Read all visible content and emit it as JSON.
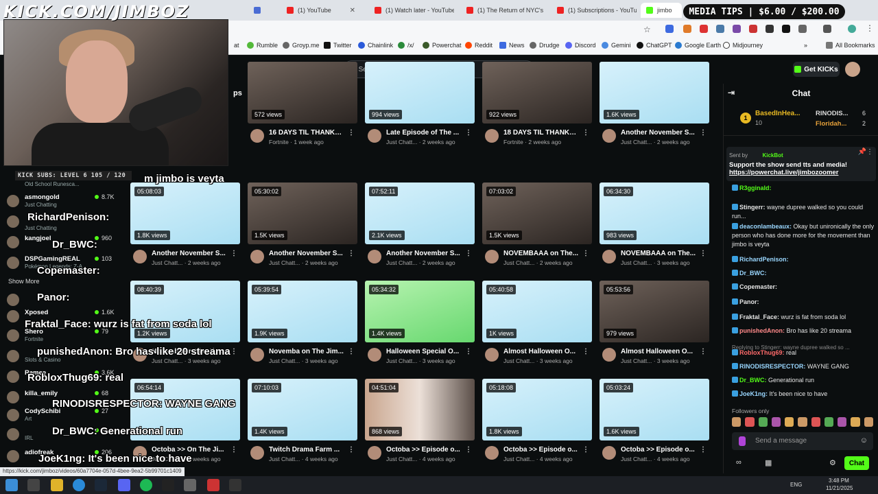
{
  "browser": {
    "tabs": [
      {
        "label": "(1) YouTube",
        "color": "#e22"
      },
      {
        "label": "(1) Watch later - YouTube",
        "color": "#e22"
      },
      {
        "label": "(1) The Return of NYC's",
        "color": "#e22"
      },
      {
        "label": "(1) Subscriptions - YouTube",
        "color": "#e22"
      },
      {
        "label": "jimbo",
        "color": "#53fc18"
      }
    ],
    "bookmarks": [
      "Rumble",
      "Groyp.me",
      "Twitter",
      "Chainlink",
      "/x/",
      "Powerchat",
      "Reddit",
      "News",
      "Drudge",
      "Discord",
      "Gemini",
      "ChatGPT",
      "Google Earth",
      "Midjourney"
    ],
    "all_bookmarks": "All Bookmarks",
    "status_url": "https://kick.com/jimboz/videos/60a7704e-057d-4bee-9ea2-5b99701c1409"
  },
  "overlay": {
    "watermark": "KICK.COM/JIMBOZ",
    "media_tips": "MEDIA TIPS | $6.00 / $200.00",
    "kick_subs": "KICK SUBS: LEVEL 6 105 / 120",
    "overlay_texts": [
      {
        "text": "m jimbo is veyta"
      },
      {
        "text": "RichardPenison:"
      },
      {
        "text": "Dr_BWC:"
      },
      {
        "text": "Copemaster:"
      },
      {
        "text": "Panor:"
      },
      {
        "text": "Fraktal_Face: wurz is fat from soda lol"
      },
      {
        "text": "punishedAnon:  Bro has like 20 streama"
      },
      {
        "text": "RobloxThug69: real"
      },
      {
        "text": "RINODISRESPECTOR: WAYNE GANG"
      },
      {
        "text": "Dr_BWC: Generational run"
      },
      {
        "text": "JoeK1ng: It's been nice to have"
      }
    ]
  },
  "header": {
    "search_placeholder": "Search",
    "get_kicks": "Get KICKs",
    "section_tail": "ps"
  },
  "sidebar": {
    "show_more": "Show More",
    "channels": [
      {
        "name": "Old School Runesca...",
        "category": "",
        "views": ""
      },
      {
        "name": "asmongold",
        "category": "Just Chatting",
        "views": "8.7K"
      },
      {
        "name": "asmon",
        "category": "Just Chatting",
        "views": ""
      },
      {
        "name": "kangjoel",
        "category": "",
        "views": "960"
      },
      {
        "name": "DSPGamingREAL",
        "category": "Pokémon Legends: Z-A",
        "views": "103"
      },
      {
        "name": "xQc",
        "category": "",
        "views": ""
      },
      {
        "name": "Xposed",
        "category": "",
        "views": "1.6K"
      },
      {
        "name": "Shero",
        "category": "Fortnite",
        "views": "79"
      },
      {
        "name": "",
        "category": "Slots & Casino",
        "views": ""
      },
      {
        "name": "Ramee",
        "category": "",
        "views": "3.6K"
      },
      {
        "name": "killa_emily",
        "category": "",
        "views": "68"
      },
      {
        "name": "CodySchibi",
        "category": "Art",
        "views": "27"
      },
      {
        "name": "",
        "category": "IRL",
        "views": "2"
      },
      {
        "name": "adiofreak",
        "category": "",
        "views": "206"
      }
    ]
  },
  "videos": [
    {
      "duration": "",
      "views": "572 views",
      "title": "16 DAYS TIL THANKSGIVING",
      "sub": "Fortnite · 1 week ago",
      "thumb": "cam"
    },
    {
      "duration": "",
      "views": "994 views",
      "title": "Late Episode of The ...",
      "sub": "Just Chatt... · 2 weeks ago",
      "thumb": "blue"
    },
    {
      "duration": "",
      "views": "922 views",
      "title": "18 DAYS TIL THANKSGIVING",
      "sub": "Fortnite · 2 weeks ago",
      "thumb": "cam"
    },
    {
      "duration": "",
      "views": "1.6K views",
      "title": "Another November S...",
      "sub": "Just Chatt... · 2 weeks ago",
      "thumb": "blue"
    },
    {
      "duration": "05:08:03",
      "views": "1.8K views",
      "title": "Another November S...",
      "sub": "Just Chatt... · 2 weeks ago",
      "thumb": "blue"
    },
    {
      "duration": "05:30:02",
      "views": "1.5K views",
      "title": "Another November S...",
      "sub": "Just Chatt... · 2 weeks ago",
      "thumb": "cam"
    },
    {
      "duration": "07:52:11",
      "views": "2.1K views",
      "title": "Another November S...",
      "sub": "Just Chatt... · 2 weeks ago",
      "thumb": "blue"
    },
    {
      "duration": "07:03:02",
      "views": "1.5K views",
      "title": "NOVEMBAAA on The...",
      "sub": "Just Chatt... · 2 weeks ago",
      "thumb": "cam"
    },
    {
      "duration": "06:34:30",
      "views": "983 views",
      "title": "NOVEMBAAA on The...",
      "sub": "Just Chatt... · 3 weeks ago",
      "thumb": "blue"
    },
    {
      "duration": "08:40:39",
      "views": "1.2K views",
      "title": "Novemba on The Jim...",
      "sub": "Just Chatt... · 3 weeks ago",
      "thumb": "blue"
    },
    {
      "duration": "05:39:54",
      "views": "1.9K views",
      "title": "Novemba on The Jim...",
      "sub": "Just Chatt... · 3 weeks ago",
      "thumb": "blue"
    },
    {
      "duration": "05:34:32",
      "views": "1.4K views",
      "title": "Halloween Special O...",
      "sub": "Just Chatt... · 3 weeks ago",
      "thumb": "green"
    },
    {
      "duration": "05:40:58",
      "views": "1K views",
      "title": "Almost Halloween O...",
      "sub": "Just Chatt... · 3 weeks ago",
      "thumb": "blue"
    },
    {
      "duration": "05:53:56",
      "views": "979 views",
      "title": "Almost Halloween O...",
      "sub": "Just Chatt... · 3 weeks ago",
      "thumb": "cam"
    },
    {
      "duration": "06:54:14",
      "views": "",
      "title": "Octoba >> On The Ji...",
      "sub": "Just Chatt... · 4 weeks ago",
      "thumb": "blue"
    },
    {
      "duration": "07:10:03",
      "views": "1.4K views",
      "title": "Twitch Drama Farm ...",
      "sub": "Just Chatt... · 4 weeks ago",
      "thumb": "blue"
    },
    {
      "duration": "04:51:04",
      "views": "868 views",
      "title": "Octoba >> Episode o...",
      "sub": "Just Chatt... · 4 weeks ago",
      "thumb": "stream"
    },
    {
      "duration": "05:18:08",
      "views": "1.8K views",
      "title": "Octoba >> Episode o...",
      "sub": "Just Chatt... · 4 weeks ago",
      "thumb": "blue"
    },
    {
      "duration": "05:03:24",
      "views": "1.6K views",
      "title": "Octoba >> Episode o...",
      "sub": "Just Chatt... · 4 weeks ago",
      "thumb": "blue"
    }
  ],
  "chat": {
    "title": "Chat",
    "leaderboard": [
      {
        "rank": "1",
        "name": "BasedInHea...",
        "count": "10"
      },
      {
        "name": "RINODIS...",
        "count": "6"
      },
      {
        "name": "Floridah...",
        "count": "2"
      }
    ],
    "pinned": {
      "sent_by": "Sent by",
      "sender": "KickBot",
      "text": "Support the show send tts and media!",
      "link": "https://powerchat.live/jimbozoomer"
    },
    "messages": [
      {
        "user": "R3gginaId:",
        "text": "",
        "color": "#53fc18"
      },
      {
        "user": "Stingerr:",
        "text": "wayne dupree walked so you could run...",
        "color": "#e6e6e6"
      },
      {
        "user": "deaconlambeaux:",
        "text": "Okay but unironically the only person who has done more for the movement than jimbo is veyta",
        "color": "#9ad7ff"
      },
      {
        "user": "RichardPenison:",
        "text": "",
        "color": "#9ad7ff"
      },
      {
        "user": "Dr_BWC:",
        "text": "",
        "color": "#9ad7ff"
      },
      {
        "user": "Copemaster:",
        "text": "",
        "color": "#e6e6e6"
      },
      {
        "user": "Panor:",
        "text": "",
        "color": "#e6e6e6"
      },
      {
        "user": "Fraktal_Face:",
        "text": "wurz is fat from soda lol",
        "color": "#e6e6e6"
      },
      {
        "user": "punishedAnon:",
        "text": "Bro has like 20 streama",
        "color": "#ff8a8a"
      },
      {
        "user": "RobloxThug69:",
        "text": "real",
        "color": "#ff6b6b"
      },
      {
        "user": "RINODISRESPECTOR:",
        "text": "WAYNE GANG",
        "color": "#9ad7ff"
      },
      {
        "user": "Dr_BWC:",
        "text": "Generational run",
        "color": "#53fc18"
      },
      {
        "user": "JoeK1ng:",
        "text": "It's been nice to have",
        "color": "#9ad7ff"
      }
    ],
    "replying": "Replying to Stingerr: wayne dupree walked so ...",
    "followers_only": "Followers only",
    "input_placeholder": "Send a message",
    "send_label": "Chat"
  },
  "taskbar": {
    "time": "3:48 PM",
    "date": "11/21/2025",
    "lang": "ENG"
  }
}
